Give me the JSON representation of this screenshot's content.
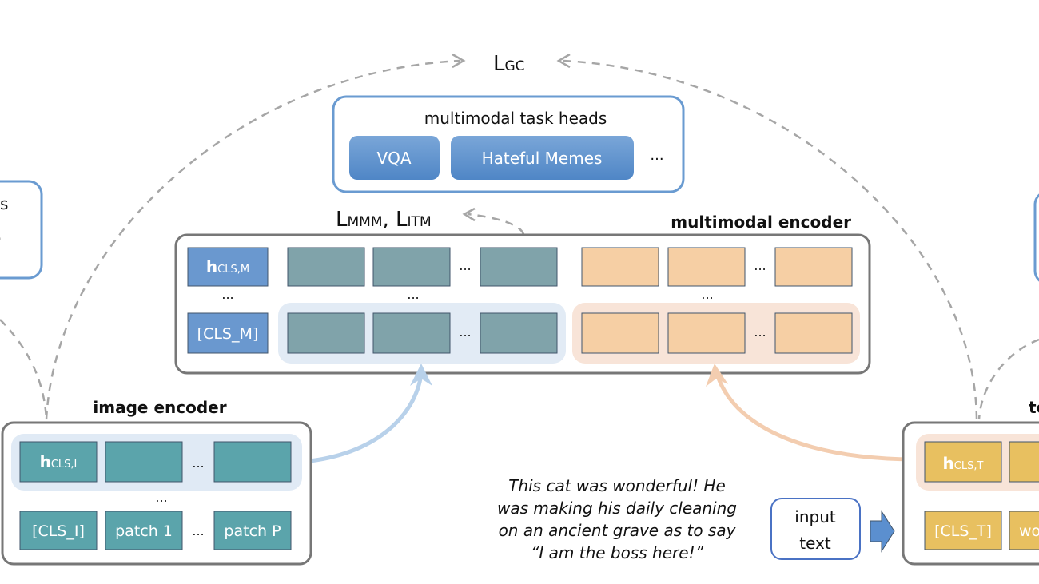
{
  "loss_gc": {
    "main": "L",
    "sub": "GC"
  },
  "loss_mmm_itm": {
    "main1": "L",
    "sub1": "MMM",
    "sep": ", ",
    "main2": "L",
    "sub2": "ITM"
  },
  "task_heads": {
    "title": "multimodal task heads",
    "items": [
      "VQA",
      "Hateful Memes"
    ],
    "more": "..."
  },
  "multimodal_encoder": {
    "title": "multimodal encoder",
    "h_cls": {
      "main": "h",
      "sub": "CLS,M"
    },
    "cls_token": "[CLS_M]",
    "ellipsis": "..."
  },
  "image_encoder": {
    "title": "image encoder",
    "h_cls": {
      "main": "h",
      "sub": "CLS,I"
    },
    "cls_token": "[CLS_I]",
    "patch_first": "patch 1",
    "patch_last": "patch P",
    "ellipsis": "..."
  },
  "text_encoder": {
    "title_partial": "te",
    "h_cls": {
      "main": "h",
      "sub": "CLS,T"
    },
    "cls_token": "[CLS_T]",
    "word_partial": "wo"
  },
  "left_box_partial": {
    "line1": "s",
    "line2": "."
  },
  "input_text": {
    "label_line1": "input",
    "label_line2": "text",
    "example_lines": [
      "This cat was wonderful! He",
      "was making his daily cleaning",
      "on an ancient grave as to say",
      "“I am the boss here!”"
    ]
  },
  "colors": {
    "image_token": "#5ba4ab",
    "mm_image_token": "#80a3aa",
    "mm_text_token": "#f6cfa4",
    "text_token": "#e8c060",
    "cls_m": "#6a98cf",
    "head_button": "#5b8fcf"
  }
}
